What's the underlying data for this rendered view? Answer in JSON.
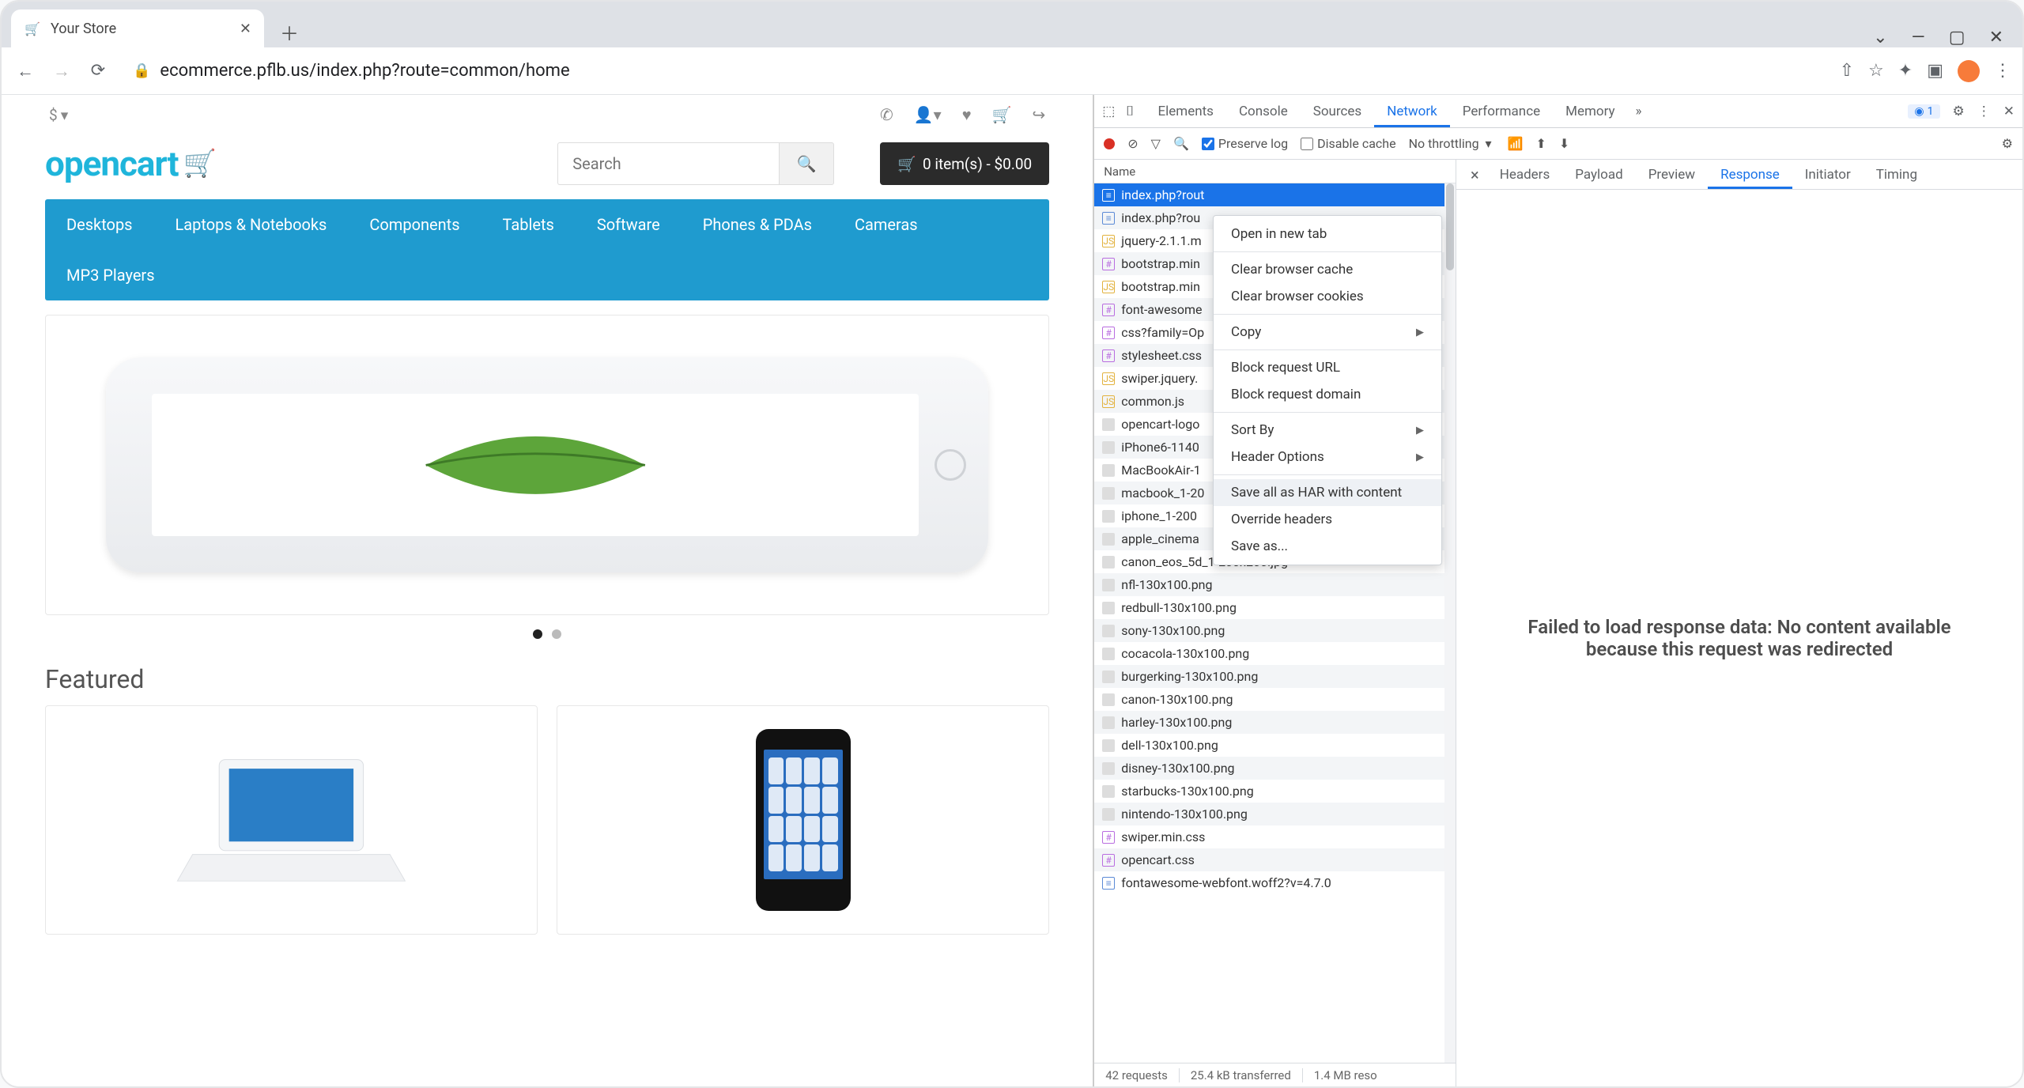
{
  "tab": {
    "title": "Your Store"
  },
  "url": "ecommerce.pflb.us/index.php?route=common/home",
  "page": {
    "currency": "$",
    "search_placeholder": "Search",
    "cart_text": "0 item(s) - $0.00",
    "nav": [
      "Desktops",
      "Laptops & Notebooks",
      "Components",
      "Tablets",
      "Software",
      "Phones & PDAs",
      "Cameras",
      "MP3 Players"
    ],
    "featured_heading": "Featured"
  },
  "devtools": {
    "tabs": [
      "Elements",
      "Console",
      "Sources",
      "Network",
      "Performance",
      "Memory"
    ],
    "active_tab": "Network",
    "issues_badge": "1",
    "toolbar": {
      "preserve_log": "Preserve log",
      "disable_cache": "Disable cache",
      "throttling": "No throttling"
    },
    "name_header": "Name",
    "requests": [
      {
        "name": "index.php?rout",
        "type": "doc",
        "selected": true
      },
      {
        "name": "index.php?rou",
        "type": "doc"
      },
      {
        "name": "jquery-2.1.1.m",
        "type": "js"
      },
      {
        "name": "bootstrap.min",
        "type": "css"
      },
      {
        "name": "bootstrap.min",
        "type": "js"
      },
      {
        "name": "font-awesome",
        "type": "css"
      },
      {
        "name": "css?family=Op",
        "type": "css"
      },
      {
        "name": "stylesheet.css",
        "type": "css"
      },
      {
        "name": "swiper.jquery.",
        "type": "js"
      },
      {
        "name": "common.js",
        "type": "js"
      },
      {
        "name": "opencart-logo",
        "type": "img"
      },
      {
        "name": "iPhone6-1140",
        "type": "img"
      },
      {
        "name": "MacBookAir-1",
        "type": "img"
      },
      {
        "name": "macbook_1-20",
        "type": "img"
      },
      {
        "name": "iphone_1-200",
        "type": "img"
      },
      {
        "name": "apple_cinema",
        "type": "img"
      },
      {
        "name": "canon_eos_5d_1-200x200.jpg",
        "type": "img"
      },
      {
        "name": "nfl-130x100.png",
        "type": "img"
      },
      {
        "name": "redbull-130x100.png",
        "type": "img"
      },
      {
        "name": "sony-130x100.png",
        "type": "img"
      },
      {
        "name": "cocacola-130x100.png",
        "type": "img"
      },
      {
        "name": "burgerking-130x100.png",
        "type": "img"
      },
      {
        "name": "canon-130x100.png",
        "type": "img"
      },
      {
        "name": "harley-130x100.png",
        "type": "img"
      },
      {
        "name": "dell-130x100.png",
        "type": "img"
      },
      {
        "name": "disney-130x100.png",
        "type": "img"
      },
      {
        "name": "starbucks-130x100.png",
        "type": "img"
      },
      {
        "name": "nintendo-130x100.png",
        "type": "img"
      },
      {
        "name": "swiper.min.css",
        "type": "css"
      },
      {
        "name": "opencart.css",
        "type": "css"
      },
      {
        "name": "fontawesome-webfont.woff2?v=4.7.0",
        "type": "doc"
      }
    ],
    "status": {
      "requests": "42 requests",
      "transferred": "25.4 kB transferred",
      "resources": "1.4 MB reso"
    },
    "subtabs": [
      "Headers",
      "Payload",
      "Preview",
      "Response",
      "Initiator",
      "Timing"
    ],
    "active_subtab": "Response",
    "response_message": "Failed to load response data: No content available because this request was redirected"
  },
  "context_menu": {
    "items": [
      {
        "label": "Open in new tab"
      },
      {
        "sep": true
      },
      {
        "label": "Clear browser cache"
      },
      {
        "label": "Clear browser cookies"
      },
      {
        "sep": true
      },
      {
        "label": "Copy",
        "submenu": true
      },
      {
        "sep": true
      },
      {
        "label": "Block request URL"
      },
      {
        "label": "Block request domain"
      },
      {
        "sep": true
      },
      {
        "label": "Sort By",
        "submenu": true
      },
      {
        "label": "Header Options",
        "submenu": true
      },
      {
        "sep": true
      },
      {
        "label": "Save all as HAR with content",
        "hover": true
      },
      {
        "label": "Override headers"
      },
      {
        "label": "Save as..."
      }
    ]
  }
}
